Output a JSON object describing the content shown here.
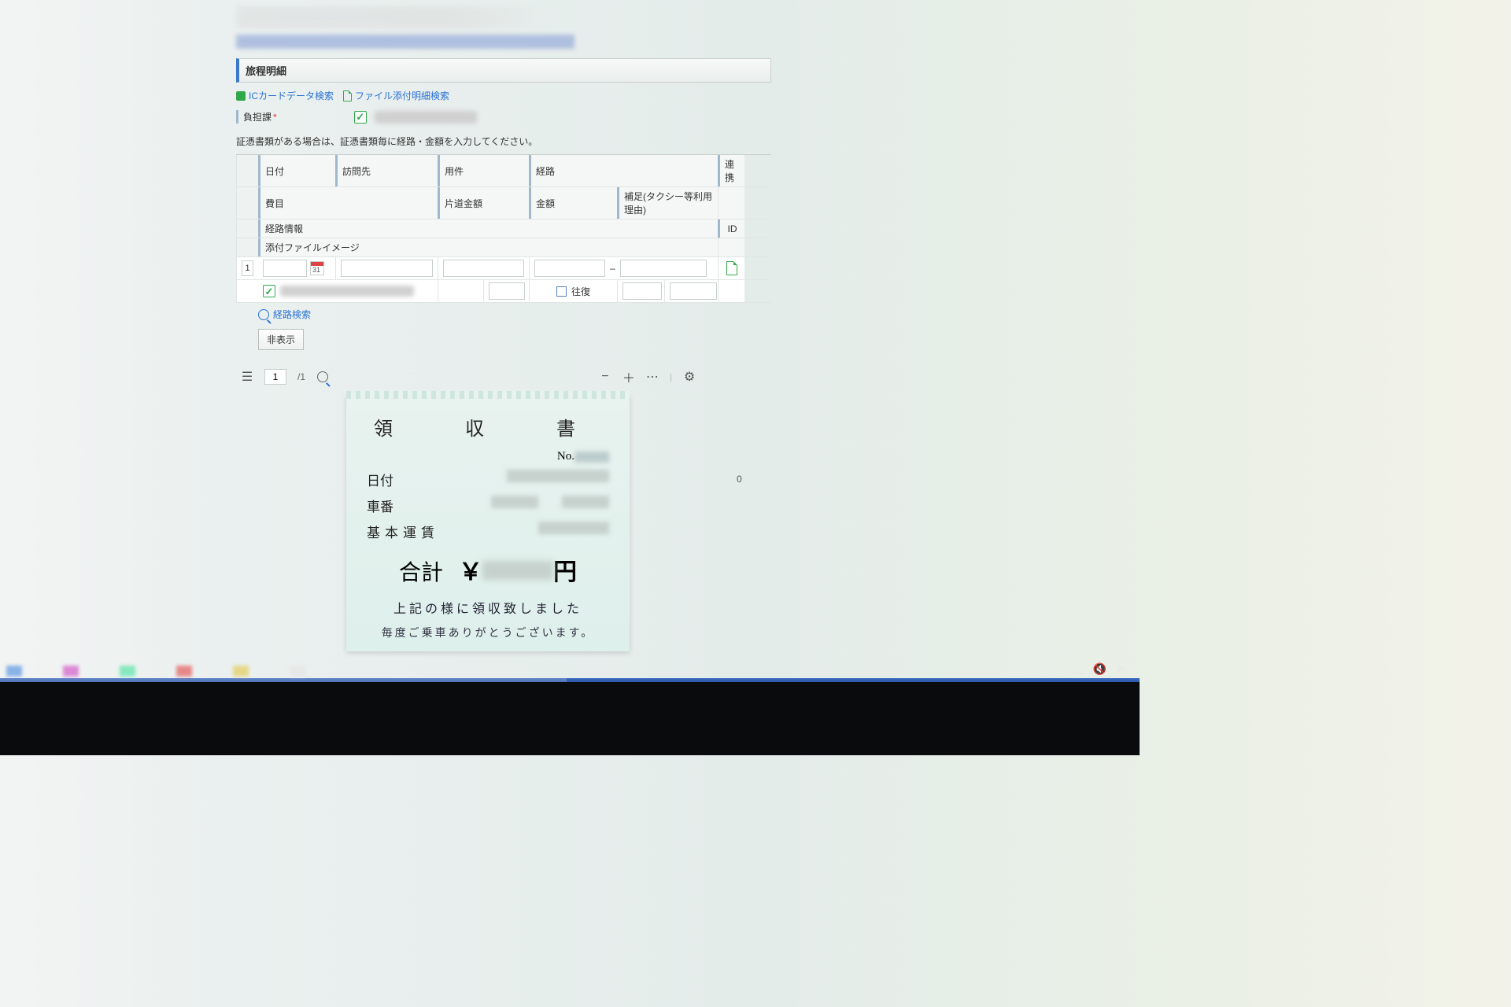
{
  "section": {
    "title": "旅程明細"
  },
  "links": {
    "ic_search": "ICカードデータ検索",
    "file_search": "ファイル添付明細検索"
  },
  "field": {
    "dept_label": "負担課",
    "required_mark": "*"
  },
  "hint": "証憑書類がある場合は、証憑書類毎に経路・金額を入力してください。",
  "headers": {
    "r1": {
      "date": "日付",
      "dest": "訪問先",
      "purpose": "用件",
      "route": "経路",
      "link": "連携"
    },
    "r2": {
      "item": "費目",
      "oneway": "片道金額",
      "amount": "金額",
      "note": "補足(タクシー等利用理由)"
    },
    "r3": {
      "routeinfo": "経路情報",
      "id": "ID"
    },
    "r4": {
      "attach": "添付ファイルイメージ"
    }
  },
  "row": {
    "num": "1",
    "roundtrip_label": "往復"
  },
  "route_search_link": "経路検索",
  "hide_button": "非表示",
  "viewer": {
    "page_current": "1",
    "page_sep": "/",
    "page_total": "1"
  },
  "receipt": {
    "title": "領　収　書",
    "no_label": "No.",
    "date_label": "日付",
    "car_label": "車番",
    "fare_label": "基本運賃",
    "total_label": "合計",
    "yen": "￥",
    "en": "円",
    "foot1": "上記の様に領収致しました",
    "foot2": "毎度ご乗車ありがとうございます。"
  },
  "stray": {
    "zero": "0"
  }
}
